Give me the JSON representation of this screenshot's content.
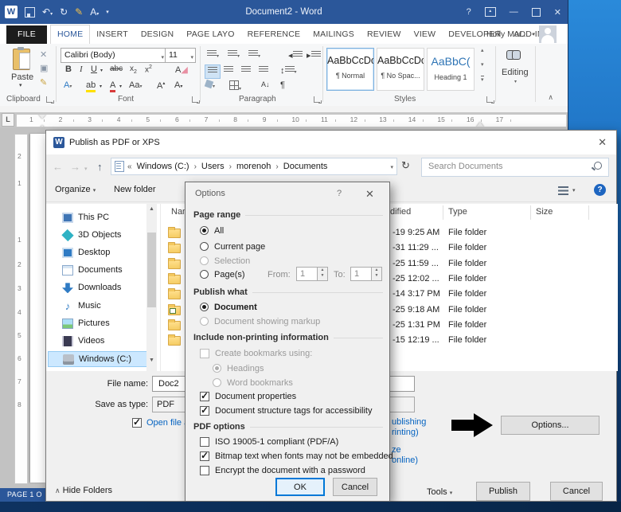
{
  "word": {
    "title": "Document2 - Word",
    "account": "Holly Mor...",
    "status": "PAGE 1 O",
    "tabs": [
      "FILE",
      "HOME",
      "INSERT",
      "DESIGN",
      "PAGE LAYO",
      "REFERENCE",
      "MAILINGS",
      "REVIEW",
      "VIEW",
      "DEVELOPER",
      "ADD-INS"
    ],
    "active_tab": "HOME",
    "ribbon": {
      "paste": "Paste",
      "clipboard_label": "Clipboard",
      "font_name": "Calibri (Body)",
      "font_size": "11",
      "font_label": "Font",
      "paragraph_label": "Paragraph",
      "styles_label": "Styles",
      "styles": [
        {
          "sample": "AaBbCcDc",
          "name": "¶ Normal",
          "selected": true,
          "accent": false
        },
        {
          "sample": "AaBbCcDc",
          "name": "¶ No Spac...",
          "selected": false,
          "accent": false
        },
        {
          "sample": "AaBbC(",
          "name": "Heading 1",
          "selected": false,
          "accent": true
        }
      ],
      "editing_label": "Editing"
    },
    "hruler_numbers": [
      "1",
      "2",
      "3",
      "4",
      "5",
      "6",
      "7",
      "8",
      "9",
      "10",
      "11",
      "12",
      "13",
      "14",
      "15",
      "16",
      "17"
    ],
    "vruler_numbers": [
      "2",
      "1",
      "1",
      "2",
      "3",
      "4",
      "5",
      "6",
      "7",
      "8"
    ]
  },
  "dialog": {
    "title": "Publish as PDF or XPS",
    "breadcrumb": {
      "prefix": "«",
      "parts": [
        "Windows (C:)",
        "Users",
        "morenoh",
        "Documents"
      ]
    },
    "search_placeholder": "Search Documents",
    "organize": "Organize",
    "new_folder": "New folder",
    "nav_items": [
      {
        "label": "This PC",
        "icon": "pc",
        "selected": false
      },
      {
        "label": "3D Objects",
        "icon": "objects3d",
        "selected": false
      },
      {
        "label": "Desktop",
        "icon": "desktop",
        "selected": false
      },
      {
        "label": "Documents",
        "icon": "documents",
        "selected": false
      },
      {
        "label": "Downloads",
        "icon": "downloads",
        "selected": false
      },
      {
        "label": "Music",
        "icon": "music",
        "selected": false
      },
      {
        "label": "Pictures",
        "icon": "pictures",
        "selected": false
      },
      {
        "label": "Videos",
        "icon": "videos",
        "selected": false
      },
      {
        "label": "Windows (C:)",
        "icon": "drive",
        "selected": true
      }
    ],
    "columns": {
      "name": "Nam",
      "modified": "dified",
      "type": "Type",
      "size": "Size"
    },
    "files": [
      {
        "modified": "-19 9:25 AM",
        "type": "File folder",
        "icon": "folder"
      },
      {
        "modified": "-31 11:29 ...",
        "type": "File folder",
        "icon": "folder"
      },
      {
        "modified": "-25 11:59 ...",
        "type": "File folder",
        "icon": "folder"
      },
      {
        "modified": "-25 12:02 ...",
        "type": "File folder",
        "icon": "folder"
      },
      {
        "modified": "-14 3:17 PM",
        "type": "File folder",
        "icon": "folder"
      },
      {
        "modified": "-25 9:18 AM",
        "type": "File folder",
        "icon": "folder-link"
      },
      {
        "modified": "-25 1:31 PM",
        "type": "File folder",
        "icon": "folder"
      },
      {
        "modified": "-15 12:19 ...",
        "type": "File folder",
        "icon": "folder"
      }
    ],
    "file_name_label": "File name:",
    "file_name_value": "Doc2",
    "save_type_label": "Save as type:",
    "save_type_value": "PDF",
    "open_after": "Open file a",
    "optimize_fragments": [
      "ublishing",
      "rinting)",
      "ze",
      "online)"
    ],
    "options_button": "Options...",
    "hide_folders": "Hide Folders",
    "tools": "Tools",
    "publish": "Publish",
    "cancel": "Cancel"
  },
  "options": {
    "title": "Options",
    "page_range": {
      "label": "Page range",
      "all": "All",
      "current": "Current page",
      "selection": "Selection",
      "pages": "Page(s)",
      "from_label": "From:",
      "from_value": "1",
      "to_label": "To:",
      "to_value": "1"
    },
    "publish_what": {
      "label": "Publish what",
      "document": "Document",
      "markup": "Document showing markup"
    },
    "non_printing": {
      "label": "Include non-printing information",
      "bookmarks": "Create bookmarks using:",
      "headings": "Headings",
      "word_bookmarks": "Word bookmarks",
      "doc_props": "Document properties",
      "structure_tags": "Document structure tags for accessibility"
    },
    "pdf_options": {
      "label": "PDF options",
      "iso": "ISO 19005-1 compliant (PDF/A)",
      "bitmap": "Bitmap text when fonts may not be embedded",
      "encrypt": "Encrypt the document with a password"
    },
    "ok": "OK",
    "cancel": "Cancel"
  },
  "icons": {
    "search": "magnifier",
    "help": "question-circle",
    "refresh": "refresh-arrow",
    "back": "arrow-left",
    "forward": "arrow-right",
    "up": "arrow-up",
    "dropdown": "chevron-down",
    "close": "x-glyph",
    "folder": "yellow-folder",
    "annotation": "thick-black-right-arrow"
  },
  "colors": {
    "titlebar": "#2b579a",
    "selection": "#cce8ff",
    "link": "#0563c1",
    "focus_border": "#0078d7",
    "heading_style": "#2e74b5"
  }
}
